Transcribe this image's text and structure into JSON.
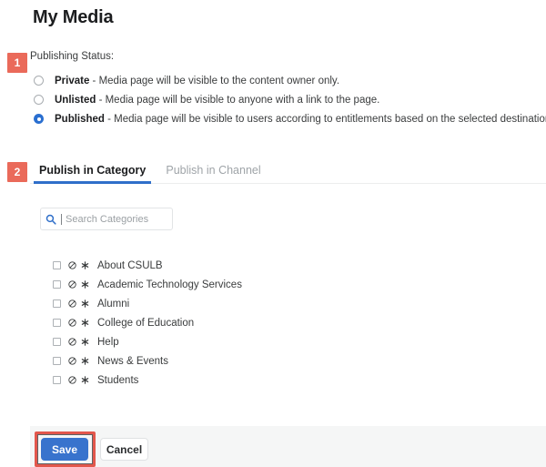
{
  "page": {
    "title": "My Media"
  },
  "steps": [
    {
      "number": "1"
    },
    {
      "number": "2"
    }
  ],
  "publishing": {
    "label": "Publishing Status:",
    "options": [
      {
        "name": "Private",
        "description": " - Media page will be visible to the content owner only.",
        "selected": false
      },
      {
        "name": "Unlisted",
        "description": " - Media page will be visible to anyone with a link to the page.",
        "selected": false
      },
      {
        "name": "Published",
        "description": " - Media page will be visible to users according to entitlements based on the selected destinations in the options below.",
        "selected": true
      }
    ]
  },
  "tabs": [
    {
      "label": "Publish in Category",
      "active": true
    },
    {
      "label": "Publish in Channel",
      "active": false
    }
  ],
  "search": {
    "placeholder": "Search Categories",
    "value": "",
    "icon": "search-icon"
  },
  "categories": [
    {
      "name": "About CSULB",
      "checked": false
    },
    {
      "name": "Academic Technology Services",
      "checked": false
    },
    {
      "name": "Alumni",
      "checked": false
    },
    {
      "name": "College of Education",
      "checked": false
    },
    {
      "name": "Help",
      "checked": false
    },
    {
      "name": "News & Events",
      "checked": false
    },
    {
      "name": "Students",
      "checked": false
    }
  ],
  "row_icons": {
    "restricted": "no-entry-icon",
    "asterisk": "asterisk-icon"
  },
  "footer": {
    "save_label": "Save",
    "cancel_label": "Cancel"
  },
  "colors": {
    "accent_blue": "#3873cd",
    "tab_underline": "#2f6fc9",
    "badge_coral": "#ea6a5a",
    "annotation_red": "#e2574c",
    "footer_bg": "#f5f6f6"
  }
}
